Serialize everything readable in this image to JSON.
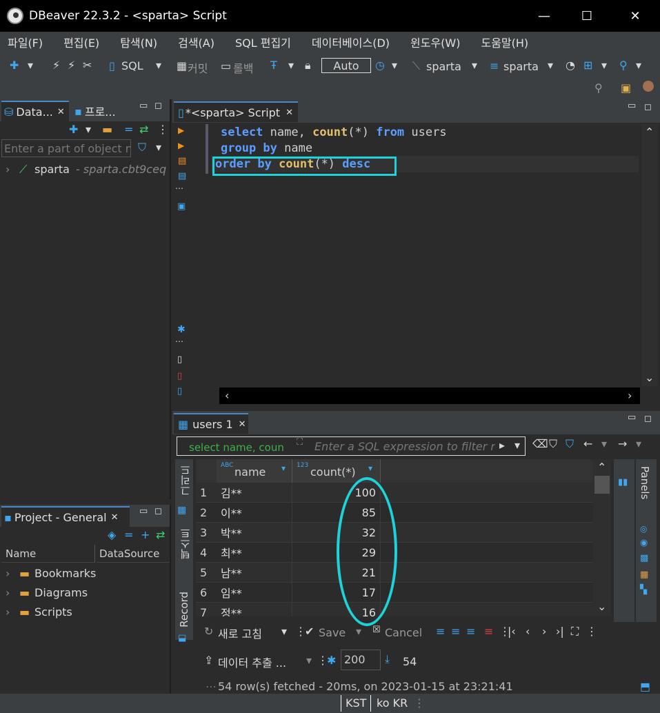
{
  "window": {
    "title": "DBeaver 22.3.2 - <sparta> Script",
    "minimize": "—",
    "maximize": "☐",
    "close": "✕"
  },
  "menu": [
    "파일(F)",
    "편집(E)",
    "탐색(N)",
    "검색(A)",
    "SQL 편집기",
    "데이터베이스(D)",
    "윈도우(W)",
    "도움말(H)"
  ],
  "toolbar": {
    "sql": "SQL",
    "commit": "커밋",
    "rollback": "롤백",
    "auto": "Auto",
    "datasource": "sparta",
    "schema": "sparta"
  },
  "navigator": {
    "tab1": "Data...",
    "tab2": "프로...",
    "filter_placeholder": "Enter a part of object n",
    "tree_item": "sparta",
    "tree_item_sub": "- sparta.cbt9ceq"
  },
  "editor": {
    "tab": "*<sparta> Script",
    "lines": [
      {
        "a": "select",
        "b": " name, ",
        "c": "count",
        "d": "(*) ",
        "e": "from",
        "f": " users"
      },
      {
        "a": "group by",
        "b": " name"
      },
      {
        "a": "order by",
        "b": " ",
        "c": "count",
        "d": "(*) ",
        "e": "desc"
      }
    ]
  },
  "results": {
    "tab": "users 1",
    "query_text": "select name, coun",
    "filter_placeholder": "Enter a SQL expression to filter r",
    "columns": [
      {
        "type": "ABC",
        "name": "name"
      },
      {
        "type": "123",
        "name": "count(*)"
      }
    ],
    "rows": [
      {
        "num": "1",
        "name": "김**",
        "count": "100"
      },
      {
        "num": "2",
        "name": "이**",
        "count": "85"
      },
      {
        "num": "3",
        "name": "박**",
        "count": "32"
      },
      {
        "num": "4",
        "name": "최**",
        "count": "29"
      },
      {
        "num": "5",
        "name": "남**",
        "count": "21"
      },
      {
        "num": "6",
        "name": "임**",
        "count": "17"
      },
      {
        "num": "7",
        "name": "정**",
        "count": "16"
      }
    ],
    "side_grid": "그리드",
    "side_text": "텍스트",
    "side_record": "Record",
    "panels": "Panels",
    "refresh": "새로 고침",
    "save": "Save",
    "cancel": "Cancel",
    "export": "데이터 추출 ...",
    "fetch_size": "200",
    "row_count": "54",
    "status": "54 row(s) fetched - 20ms, on 2023-01-15 at 23:21:41"
  },
  "project": {
    "tab": "Project - General",
    "col_name": "Name",
    "col_ds": "DataSource",
    "items": [
      "Bookmarks",
      "Diagrams",
      "Scripts"
    ]
  },
  "statusbar": {
    "tz": "KST",
    "locale": "ko  KR"
  },
  "colors": {
    "highlight": "#1fd1d9",
    "keyword": "#5a9fff",
    "function": "#e3c06a"
  }
}
